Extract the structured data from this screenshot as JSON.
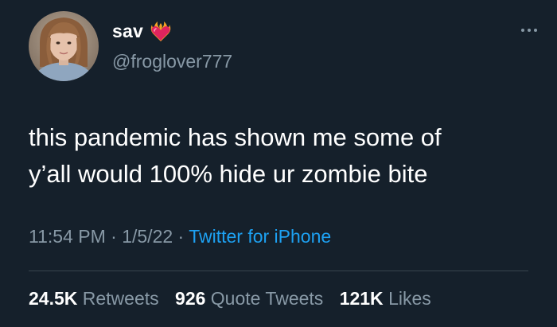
{
  "user": {
    "display_name": "sav",
    "handle": "@froglover777",
    "badge_icon": "heart-on-fire-icon",
    "avatar": "profile-photo"
  },
  "tweet": {
    "lines": [
      "this pandemic has shown me some of",
      "y’all would 100% hide ur zombie bite"
    ],
    "time": "11:54 PM",
    "date": "1/5/22",
    "separator": "·",
    "source": "Twitter for iPhone"
  },
  "stats": {
    "retweets_count": "24.5K",
    "retweets_label": "Retweets",
    "quote_tweets_count": "926",
    "quote_tweets_label": "Quote Tweets",
    "likes_count": "121K",
    "likes_label": "Likes"
  },
  "colors": {
    "background": "#15202b",
    "text": "#ffffff",
    "secondary": "#8899a6",
    "link": "#1da1f2",
    "divider": "#38444d"
  }
}
